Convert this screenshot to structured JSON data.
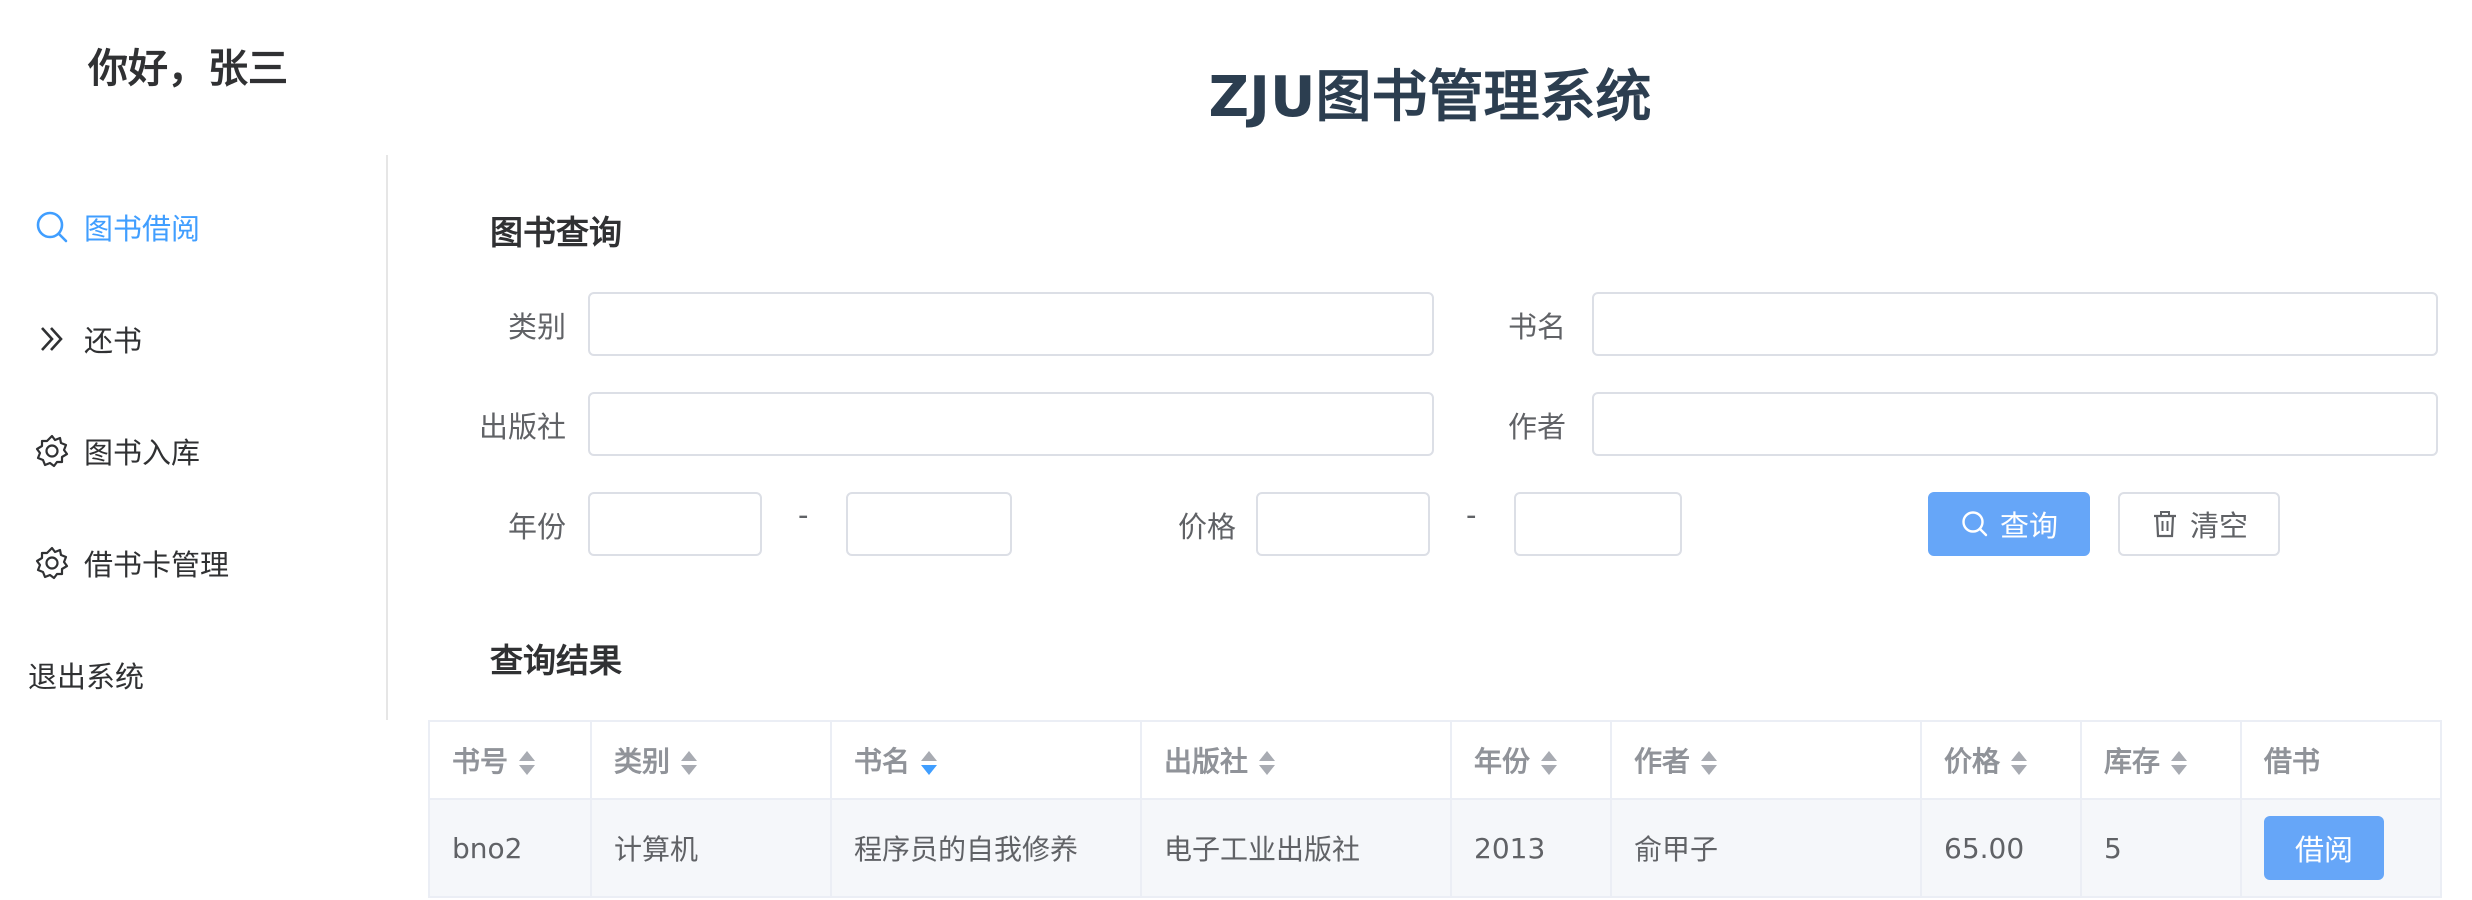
{
  "header": {
    "greeting": "你好，张三",
    "app_title": "ZJU图书管理系统"
  },
  "sidebar": {
    "items": [
      {
        "label": "图书借阅",
        "icon": "search-icon",
        "active": true
      },
      {
        "label": "还书",
        "icon": "double-chevron-right-icon",
        "active": false
      },
      {
        "label": "图书入库",
        "icon": "gear-icon",
        "active": false
      },
      {
        "label": "借书卡管理",
        "icon": "gear-icon",
        "active": false
      }
    ],
    "logout_label": "退出系统"
  },
  "query": {
    "section_title": "图书查询",
    "category_label": "类别",
    "category_value": "",
    "title_label": "书名",
    "title_value": "",
    "publisher_label": "出版社",
    "publisher_value": "",
    "author_label": "作者",
    "author_value": "",
    "year_label": "年份",
    "year_from": "",
    "year_to": "",
    "price_label": "价格",
    "price_from": "",
    "price_to": "",
    "range_separator": "-",
    "search_button": "查询",
    "clear_button": "清空"
  },
  "results": {
    "section_title": "查询结果",
    "columns": [
      "书号",
      "类别",
      "书名",
      "出版社",
      "年份",
      "作者",
      "价格",
      "库存",
      "借书"
    ],
    "sorted_column": "书名",
    "rows": [
      {
        "book_id": "bno2",
        "category": "计算机",
        "title": "程序员的自我修养",
        "publisher": "电子工业出版社",
        "year": "2013",
        "author": "俞甲子",
        "price": "65.00",
        "stock": "5",
        "action": "借阅"
      }
    ]
  },
  "colors": {
    "accent": "#409eff",
    "primary_button": "#66a6f8",
    "border": "#dcdfe6",
    "row_background": "#f5f7fa"
  }
}
